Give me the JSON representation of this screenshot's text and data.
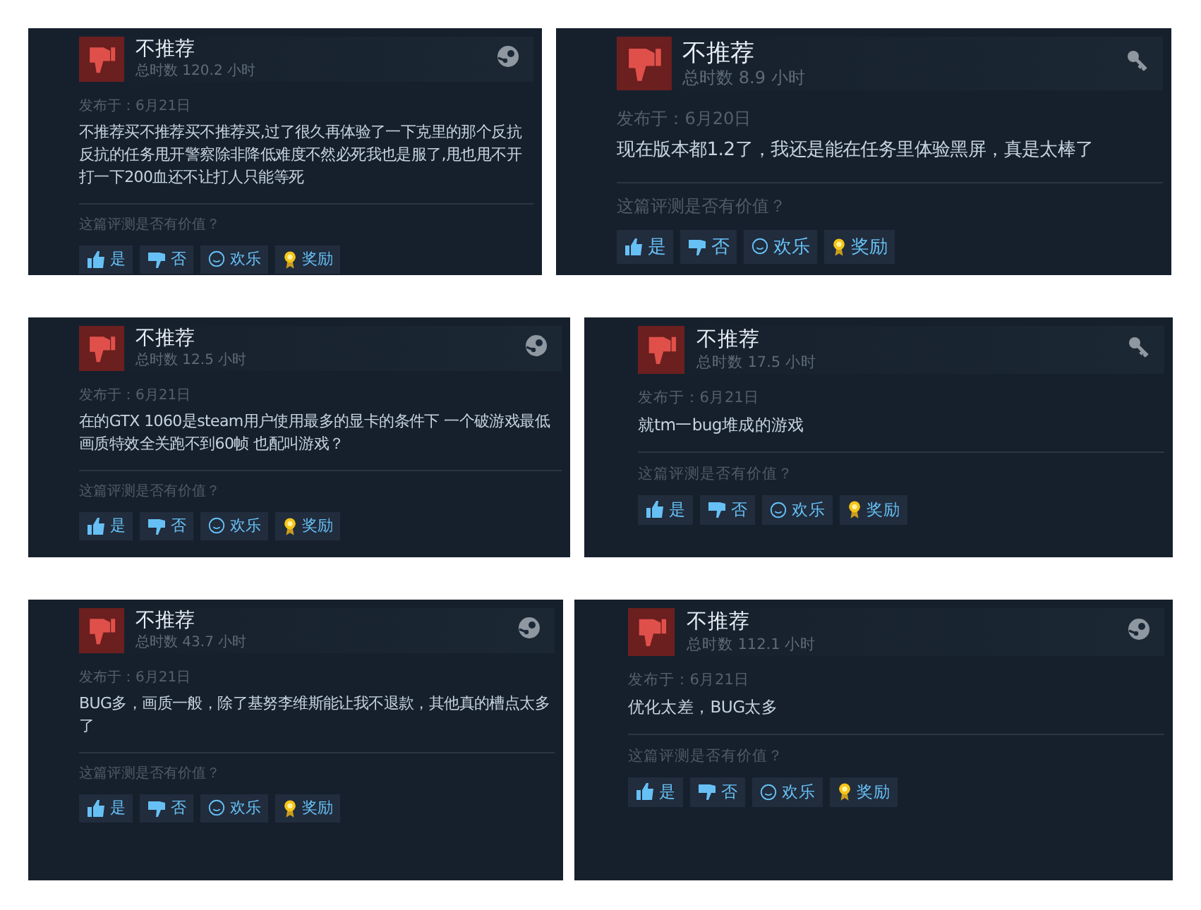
{
  "reviews": [
    {
      "verdict": "不推荐",
      "hours": "总时数 120.2 小时",
      "kind": "steam",
      "posted": "发布于：6月21日",
      "text": "不推荐买不推荐买不推荐买,过了很久再体验了一下克里的那个反抗反抗的任务甩开警察除非降低难度不然必死我也是服了,甩也甩不开打一下200血还不让打人只能等死",
      "question": "这篇评测是否有价值？",
      "buttons": [
        {
          "kind": "yes",
          "label": "是"
        },
        {
          "kind": "no",
          "label": "否"
        },
        {
          "kind": "funny",
          "label": "欢乐"
        },
        {
          "kind": "award",
          "label": "奖励"
        }
      ]
    },
    {
      "verdict": "不推荐",
      "hours": "总时数 8.9 小时",
      "kind": "key",
      "posted": "发布于：6月20日",
      "text": "现在版本都1.2了，我还是能在任务里体验黑屏，真是太棒了",
      "question": "这篇评测是否有价值？",
      "buttons": [
        {
          "kind": "yes",
          "label": "是"
        },
        {
          "kind": "no",
          "label": "否"
        },
        {
          "kind": "funny",
          "label": "欢乐"
        },
        {
          "kind": "award",
          "label": "奖励"
        }
      ]
    },
    {
      "verdict": "不推荐",
      "hours": "总时数 12.5 小时",
      "kind": "steam",
      "posted": "发布于：6月21日",
      "text": "在的GTX 1060是steam用户使用最多的显卡的条件下 一个破游戏最低画质特效全关跑不到60帧 也配叫游戏？",
      "question": "这篇评测是否有价值？",
      "buttons": [
        {
          "kind": "yes",
          "label": "是"
        },
        {
          "kind": "no",
          "label": "否"
        },
        {
          "kind": "funny",
          "label": "欢乐"
        },
        {
          "kind": "award",
          "label": "奖励"
        }
      ]
    },
    {
      "verdict": "不推荐",
      "hours": "总时数 17.5 小时",
      "kind": "key",
      "posted": "发布于：6月21日",
      "text": "就tm一bug堆成的游戏",
      "question": "这篇评测是否有价值？",
      "buttons": [
        {
          "kind": "yes",
          "label": "是"
        },
        {
          "kind": "no",
          "label": "否"
        },
        {
          "kind": "funny",
          "label": "欢乐"
        },
        {
          "kind": "award",
          "label": "奖励"
        }
      ]
    },
    {
      "verdict": "不推荐",
      "hours": "总时数 43.7 小时",
      "kind": "steam",
      "posted": "发布于：6月21日",
      "text": "BUG多，画质一般，除了基努李维斯能让我不退款，其他真的槽点太多了",
      "question": "这篇评测是否有价值？",
      "buttons": [
        {
          "kind": "yes",
          "label": "是"
        },
        {
          "kind": "no",
          "label": "否"
        },
        {
          "kind": "funny",
          "label": "欢乐"
        },
        {
          "kind": "award",
          "label": "奖励"
        }
      ]
    },
    {
      "verdict": "不推荐",
      "hours": "总时数 112.1 小时",
      "kind": "steam",
      "posted": "发布于：6月21日",
      "text": "优化太差，BUG太多",
      "question": "这篇评测是否有价值？",
      "buttons": [
        {
          "kind": "yes",
          "label": "是"
        },
        {
          "kind": "no",
          "label": "否"
        },
        {
          "kind": "funny",
          "label": "欢乐"
        },
        {
          "kind": "award",
          "label": "奖励"
        }
      ]
    }
  ]
}
